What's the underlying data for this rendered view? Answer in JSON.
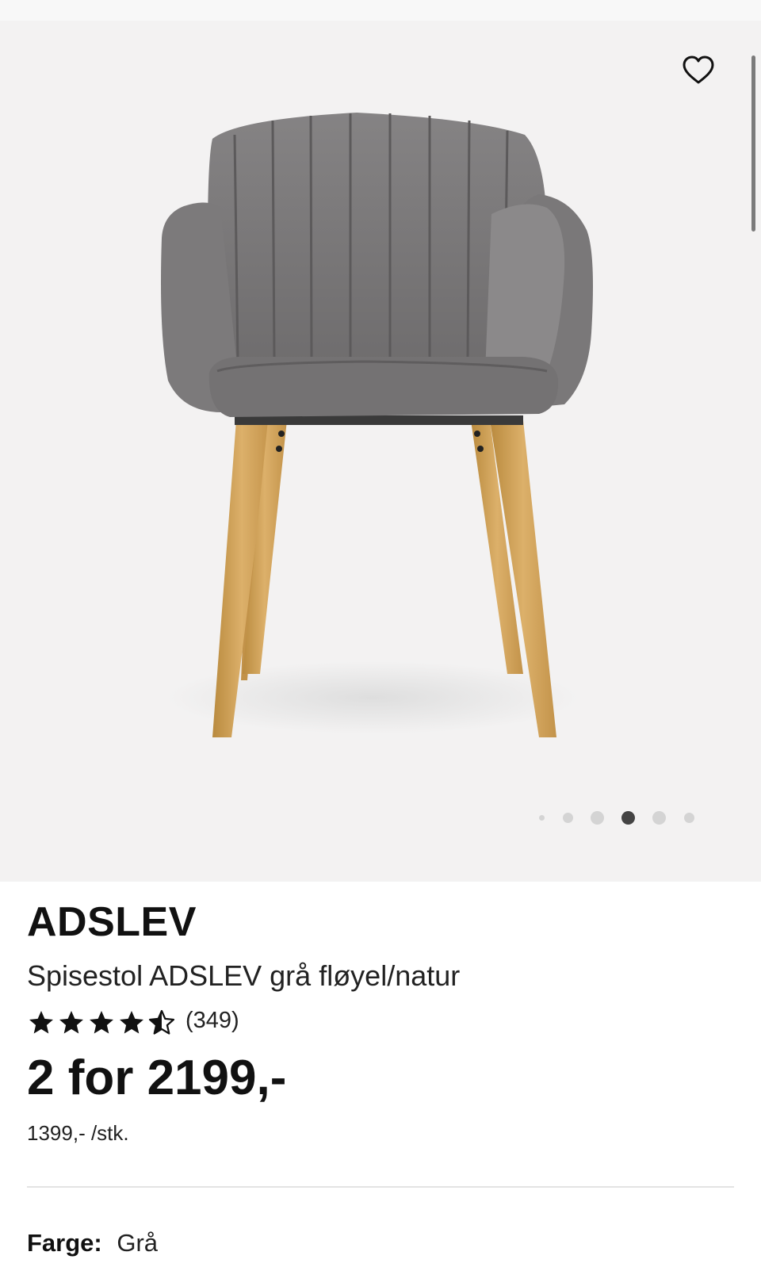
{
  "product": {
    "brand": "ADSLEV",
    "name": "Spisestol ADSLEV grå fløyel/natur",
    "rating": 4.5,
    "rating_max": 5,
    "review_count": "(349)",
    "price": "2 for 2199,-",
    "unit_price": "1399,- /stk.",
    "color_label": "Farge:",
    "color_value": "Grå"
  },
  "gallery": {
    "image_subject": "chair",
    "image_count": 6,
    "active_index": 3
  },
  "icons": {
    "favorite": "heart-icon",
    "rating_star": "star-icon"
  },
  "colors": {
    "gallery_bg": "#f3f2f2",
    "text": "#111111",
    "dot_active": "#444444",
    "dot_inactive": "#d4d4d4",
    "divider": "#e3e3e3"
  }
}
